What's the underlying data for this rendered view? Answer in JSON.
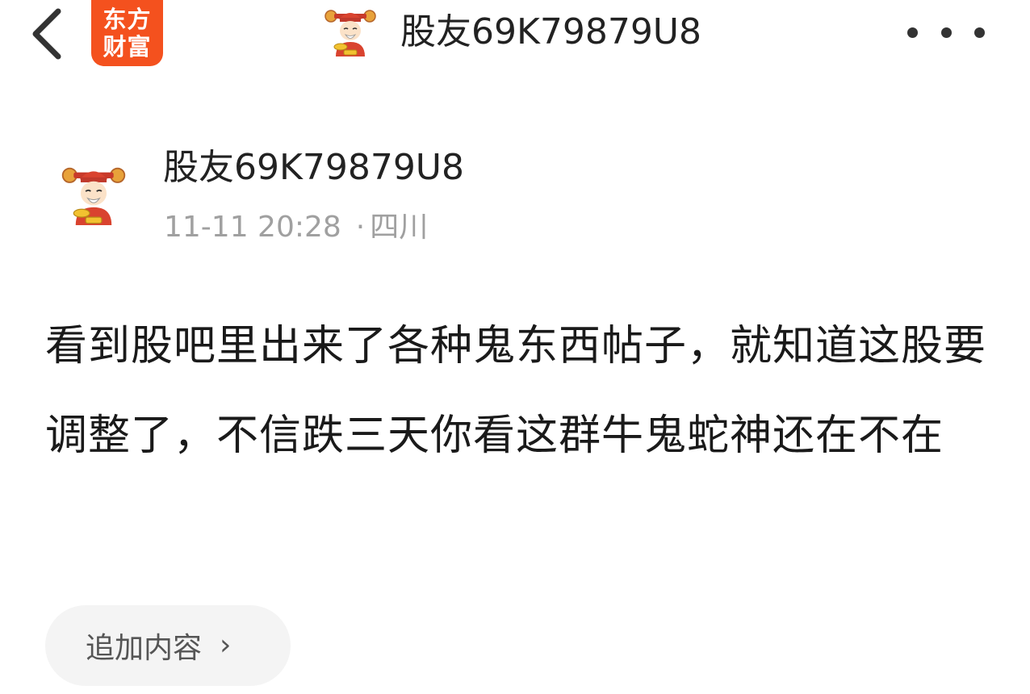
{
  "header": {
    "brand_line1": "东方",
    "brand_line2": "财富",
    "title": "股友69K79879U8",
    "back_icon": "chevron-left-icon",
    "more_icon": "more-horizontal-icon"
  },
  "post": {
    "author_name": "股友69K79879U8",
    "timestamp": "11-11 20:28",
    "separator": "·",
    "location": "四川",
    "content": "看到股吧里出来了各种鬼东西帖子，就知道这股要调整了，不信跌三天你看这群牛鬼蛇神还在不在"
  },
  "actions": {
    "append_label": "追加内容",
    "append_chevron": "›"
  },
  "colors": {
    "brand": "#f4511e",
    "text_primary": "#222222",
    "text_muted": "#a0a0a0",
    "button_bg": "#f4f4f4"
  }
}
